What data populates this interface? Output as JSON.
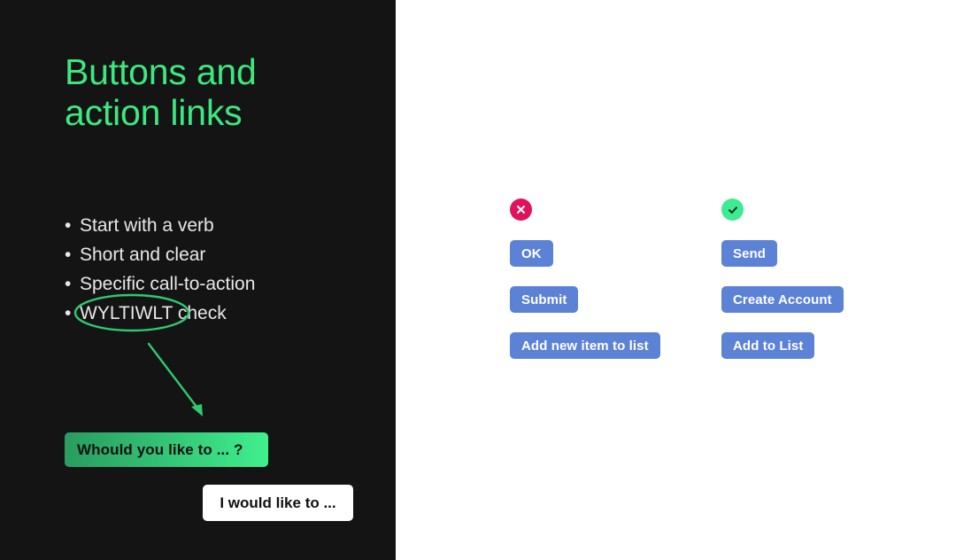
{
  "slide": {
    "title": "Buttons and\naction links",
    "title_color": "#3ce87f",
    "panel_bg": "#141414",
    "annotation_color": "#2fc96f"
  },
  "guidelines": [
    {
      "text": "Start with a verb"
    },
    {
      "text": "Short and clear"
    },
    {
      "text": "Specific call-to-action"
    },
    {
      "text": "WYLTIWLT check"
    }
  ],
  "demo": {
    "question_button": {
      "label": "Whould you like to ... ?",
      "gradient_from": "#2a9c5e",
      "gradient_to": "#40f08d",
      "text_color": "#111111"
    },
    "answer_button": {
      "label": "I would like to ...",
      "bg": "#ffffff",
      "text_color": "#111111"
    }
  },
  "examples": {
    "accent_blue": "#5c82d6",
    "bad": {
      "badge_icon": "cross-icon",
      "badge_glyph": "✕",
      "badge_color": "#e0125c",
      "buttons": [
        {
          "label": "OK"
        },
        {
          "label": "Submit"
        },
        {
          "label": "Add new item to list"
        }
      ]
    },
    "good": {
      "badge_icon": "check-icon",
      "badge_glyph": "✓",
      "badge_color": "#3ceb92",
      "buttons": [
        {
          "label": "Send"
        },
        {
          "label": "Create Account"
        },
        {
          "label": "Add to List"
        }
      ]
    }
  }
}
